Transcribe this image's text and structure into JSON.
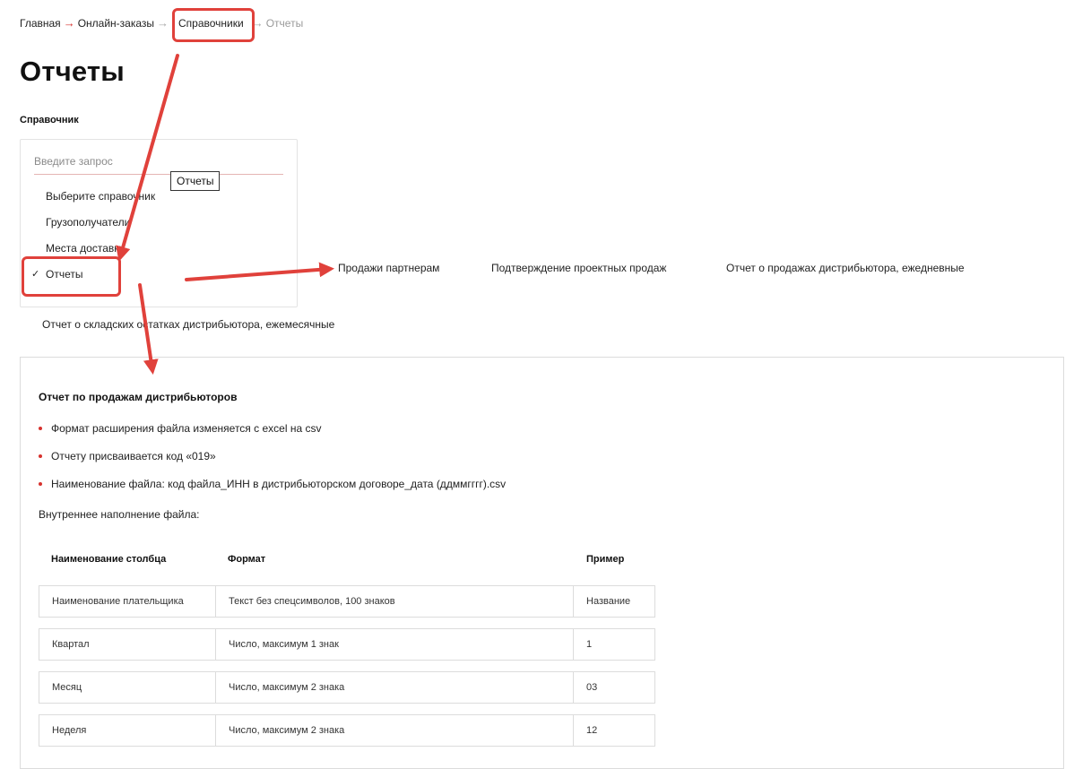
{
  "breadcrumb": {
    "home": "Главная",
    "orders": "Онлайн-заказы",
    "directories": "Справочники",
    "current": "Отчеты",
    "sep": "→"
  },
  "page_title": "Отчеты",
  "directory_label": "Справочник",
  "dropdown": {
    "placeholder": "Введите запрос",
    "items": [
      "Выберите справочник",
      "Грузополучатели",
      "Места доставки",
      "Отчеты"
    ],
    "check_symbol": "✓",
    "tooltip": "Отчеты"
  },
  "subtabs": [
    "Продажи партнерам",
    "Подтверждение проектных продаж",
    "Отчет о продажах дистрибьютора, ежедневные",
    "Отчет о складских остатках дистрибьютора, ежемесячные"
  ],
  "content": {
    "title": "Отчет по продажам дистрибьюторов",
    "bullets": [
      "Формат расширения файла изменяется с excel на csv",
      "Отчету присваивается код «019»",
      "Наименование файла: код файла_ИНН в дистрибьюторском договоре_дата (ддммгггг).csv"
    ],
    "intro": "Внутреннее наполнение файла:",
    "table": {
      "headers": [
        "Наименование столбца",
        "Формат",
        "Пример"
      ],
      "rows": [
        [
          "Наименование плательщика",
          "Текст без спецсимволов, 100 знаков",
          "Название"
        ],
        [
          "Квартал",
          "Число, максимум 1 знак",
          "1"
        ],
        [
          "Месяц",
          "Число, максимум 2 знака",
          "03"
        ],
        [
          "Неделя",
          "Число, максимум 2 знака",
          "12"
        ]
      ]
    }
  },
  "colors": {
    "accent": "#d7322e",
    "annotation": "#e0413b",
    "border": "#dcdcdc"
  }
}
